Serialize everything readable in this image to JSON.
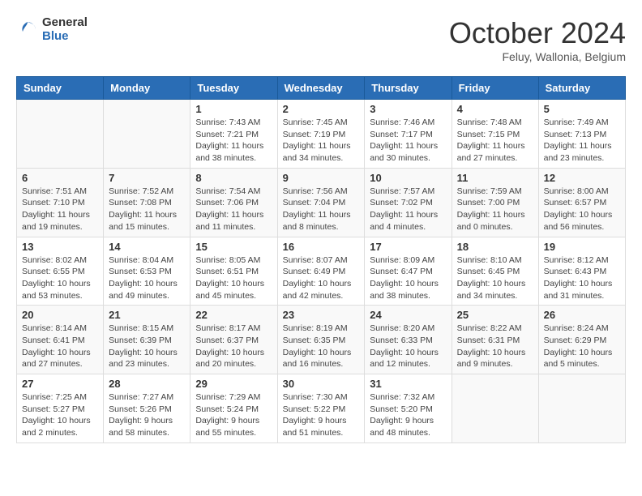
{
  "header": {
    "logo_general": "General",
    "logo_blue": "Blue",
    "month_title": "October 2024",
    "location": "Feluy, Wallonia, Belgium"
  },
  "days_of_week": [
    "Sunday",
    "Monday",
    "Tuesday",
    "Wednesday",
    "Thursday",
    "Friday",
    "Saturday"
  ],
  "weeks": [
    [
      {
        "day": "",
        "info": ""
      },
      {
        "day": "",
        "info": ""
      },
      {
        "day": "1",
        "info": "Sunrise: 7:43 AM\nSunset: 7:21 PM\nDaylight: 11 hours and 38 minutes."
      },
      {
        "day": "2",
        "info": "Sunrise: 7:45 AM\nSunset: 7:19 PM\nDaylight: 11 hours and 34 minutes."
      },
      {
        "day": "3",
        "info": "Sunrise: 7:46 AM\nSunset: 7:17 PM\nDaylight: 11 hours and 30 minutes."
      },
      {
        "day": "4",
        "info": "Sunrise: 7:48 AM\nSunset: 7:15 PM\nDaylight: 11 hours and 27 minutes."
      },
      {
        "day": "5",
        "info": "Sunrise: 7:49 AM\nSunset: 7:13 PM\nDaylight: 11 hours and 23 minutes."
      }
    ],
    [
      {
        "day": "6",
        "info": "Sunrise: 7:51 AM\nSunset: 7:10 PM\nDaylight: 11 hours and 19 minutes."
      },
      {
        "day": "7",
        "info": "Sunrise: 7:52 AM\nSunset: 7:08 PM\nDaylight: 11 hours and 15 minutes."
      },
      {
        "day": "8",
        "info": "Sunrise: 7:54 AM\nSunset: 7:06 PM\nDaylight: 11 hours and 11 minutes."
      },
      {
        "day": "9",
        "info": "Sunrise: 7:56 AM\nSunset: 7:04 PM\nDaylight: 11 hours and 8 minutes."
      },
      {
        "day": "10",
        "info": "Sunrise: 7:57 AM\nSunset: 7:02 PM\nDaylight: 11 hours and 4 minutes."
      },
      {
        "day": "11",
        "info": "Sunrise: 7:59 AM\nSunset: 7:00 PM\nDaylight: 11 hours and 0 minutes."
      },
      {
        "day": "12",
        "info": "Sunrise: 8:00 AM\nSunset: 6:57 PM\nDaylight: 10 hours and 56 minutes."
      }
    ],
    [
      {
        "day": "13",
        "info": "Sunrise: 8:02 AM\nSunset: 6:55 PM\nDaylight: 10 hours and 53 minutes."
      },
      {
        "day": "14",
        "info": "Sunrise: 8:04 AM\nSunset: 6:53 PM\nDaylight: 10 hours and 49 minutes."
      },
      {
        "day": "15",
        "info": "Sunrise: 8:05 AM\nSunset: 6:51 PM\nDaylight: 10 hours and 45 minutes."
      },
      {
        "day": "16",
        "info": "Sunrise: 8:07 AM\nSunset: 6:49 PM\nDaylight: 10 hours and 42 minutes."
      },
      {
        "day": "17",
        "info": "Sunrise: 8:09 AM\nSunset: 6:47 PM\nDaylight: 10 hours and 38 minutes."
      },
      {
        "day": "18",
        "info": "Sunrise: 8:10 AM\nSunset: 6:45 PM\nDaylight: 10 hours and 34 minutes."
      },
      {
        "day": "19",
        "info": "Sunrise: 8:12 AM\nSunset: 6:43 PM\nDaylight: 10 hours and 31 minutes."
      }
    ],
    [
      {
        "day": "20",
        "info": "Sunrise: 8:14 AM\nSunset: 6:41 PM\nDaylight: 10 hours and 27 minutes."
      },
      {
        "day": "21",
        "info": "Sunrise: 8:15 AM\nSunset: 6:39 PM\nDaylight: 10 hours and 23 minutes."
      },
      {
        "day": "22",
        "info": "Sunrise: 8:17 AM\nSunset: 6:37 PM\nDaylight: 10 hours and 20 minutes."
      },
      {
        "day": "23",
        "info": "Sunrise: 8:19 AM\nSunset: 6:35 PM\nDaylight: 10 hours and 16 minutes."
      },
      {
        "day": "24",
        "info": "Sunrise: 8:20 AM\nSunset: 6:33 PM\nDaylight: 10 hours and 12 minutes."
      },
      {
        "day": "25",
        "info": "Sunrise: 8:22 AM\nSunset: 6:31 PM\nDaylight: 10 hours and 9 minutes."
      },
      {
        "day": "26",
        "info": "Sunrise: 8:24 AM\nSunset: 6:29 PM\nDaylight: 10 hours and 5 minutes."
      }
    ],
    [
      {
        "day": "27",
        "info": "Sunrise: 7:25 AM\nSunset: 5:27 PM\nDaylight: 10 hours and 2 minutes."
      },
      {
        "day": "28",
        "info": "Sunrise: 7:27 AM\nSunset: 5:26 PM\nDaylight: 9 hours and 58 minutes."
      },
      {
        "day": "29",
        "info": "Sunrise: 7:29 AM\nSunset: 5:24 PM\nDaylight: 9 hours and 55 minutes."
      },
      {
        "day": "30",
        "info": "Sunrise: 7:30 AM\nSunset: 5:22 PM\nDaylight: 9 hours and 51 minutes."
      },
      {
        "day": "31",
        "info": "Sunrise: 7:32 AM\nSunset: 5:20 PM\nDaylight: 9 hours and 48 minutes."
      },
      {
        "day": "",
        "info": ""
      },
      {
        "day": "",
        "info": ""
      }
    ]
  ]
}
